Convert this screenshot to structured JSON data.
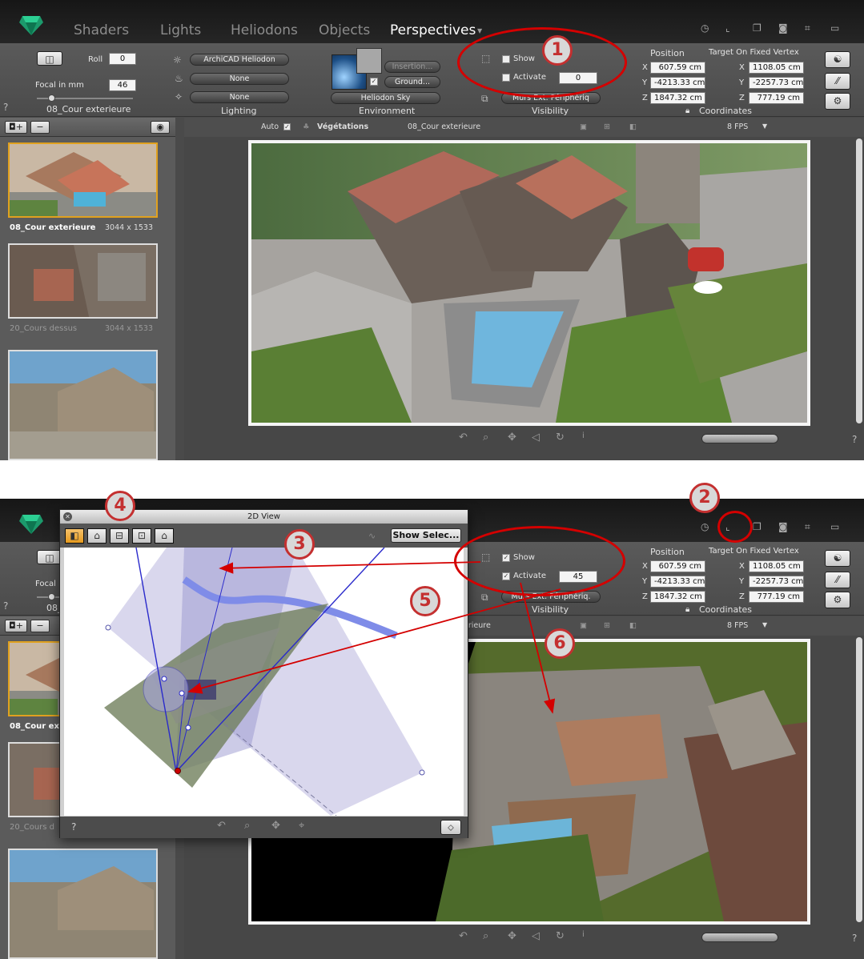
{
  "tabs": [
    "Shaders",
    "Lights",
    "Heliodons",
    "Objects",
    "Perspectives"
  ],
  "camera": {
    "roll_label": "Roll",
    "roll_value": "0",
    "focal_label": "Focal in mm",
    "focal_value": "46",
    "focal_short_label": "Focal",
    "name": "08_Cour exterieure",
    "name_short": "08_"
  },
  "lighting": {
    "heliodon": "ArchiCAD Heliodon",
    "light2": "None",
    "light3": "None",
    "label": "Lighting"
  },
  "environment": {
    "insertion": "Insertion...",
    "ground": "Ground...",
    "sky": "Heliodon Sky",
    "label": "Environment"
  },
  "visibility": {
    "show_label": "Show",
    "activate_label": "Activate",
    "value_top": "0",
    "value_bottom": "45",
    "layer": "Murs Ext: Périphériq",
    "layer_bottom": "Murs Ext: Périphériq.",
    "label": "Visibility"
  },
  "coordinates": {
    "position_label": "Position",
    "target_label": "Target On Fixed Vertex",
    "x_label": "X",
    "y_label": "Y",
    "z_label": "Z",
    "px": "607.59 cm",
    "py": "-4213.33 cm",
    "pz": "1847.32 cm",
    "tx": "1108.05 cm",
    "ty": "-2257.73 cm",
    "tz": "777.19 cm",
    "label": "Coordinates"
  },
  "viewbar": {
    "auto_label": "Auto",
    "vegetation": "Végétations",
    "camera_name": "08_Cour exterieure",
    "camera_name_partial": "erieure",
    "fps": "8 FPS"
  },
  "thumbnails": [
    {
      "name": "08_Cour exterieure",
      "size": "3044 x 1533",
      "short": "08_Cour ex"
    },
    {
      "name": "20_Cours dessus",
      "size": "3044 x 1533",
      "short": "20_Cours d"
    },
    {
      "name": "",
      "size": ""
    }
  ],
  "dialog": {
    "title": "2D View",
    "show_select": "Show Selec..."
  },
  "callouts": [
    "1",
    "2",
    "3",
    "4",
    "5",
    "6"
  ],
  "help": "?",
  "colors": {
    "callout": "#c43030",
    "selected_thumb": "#e0a11f",
    "frustum": "#3a3ad0"
  }
}
